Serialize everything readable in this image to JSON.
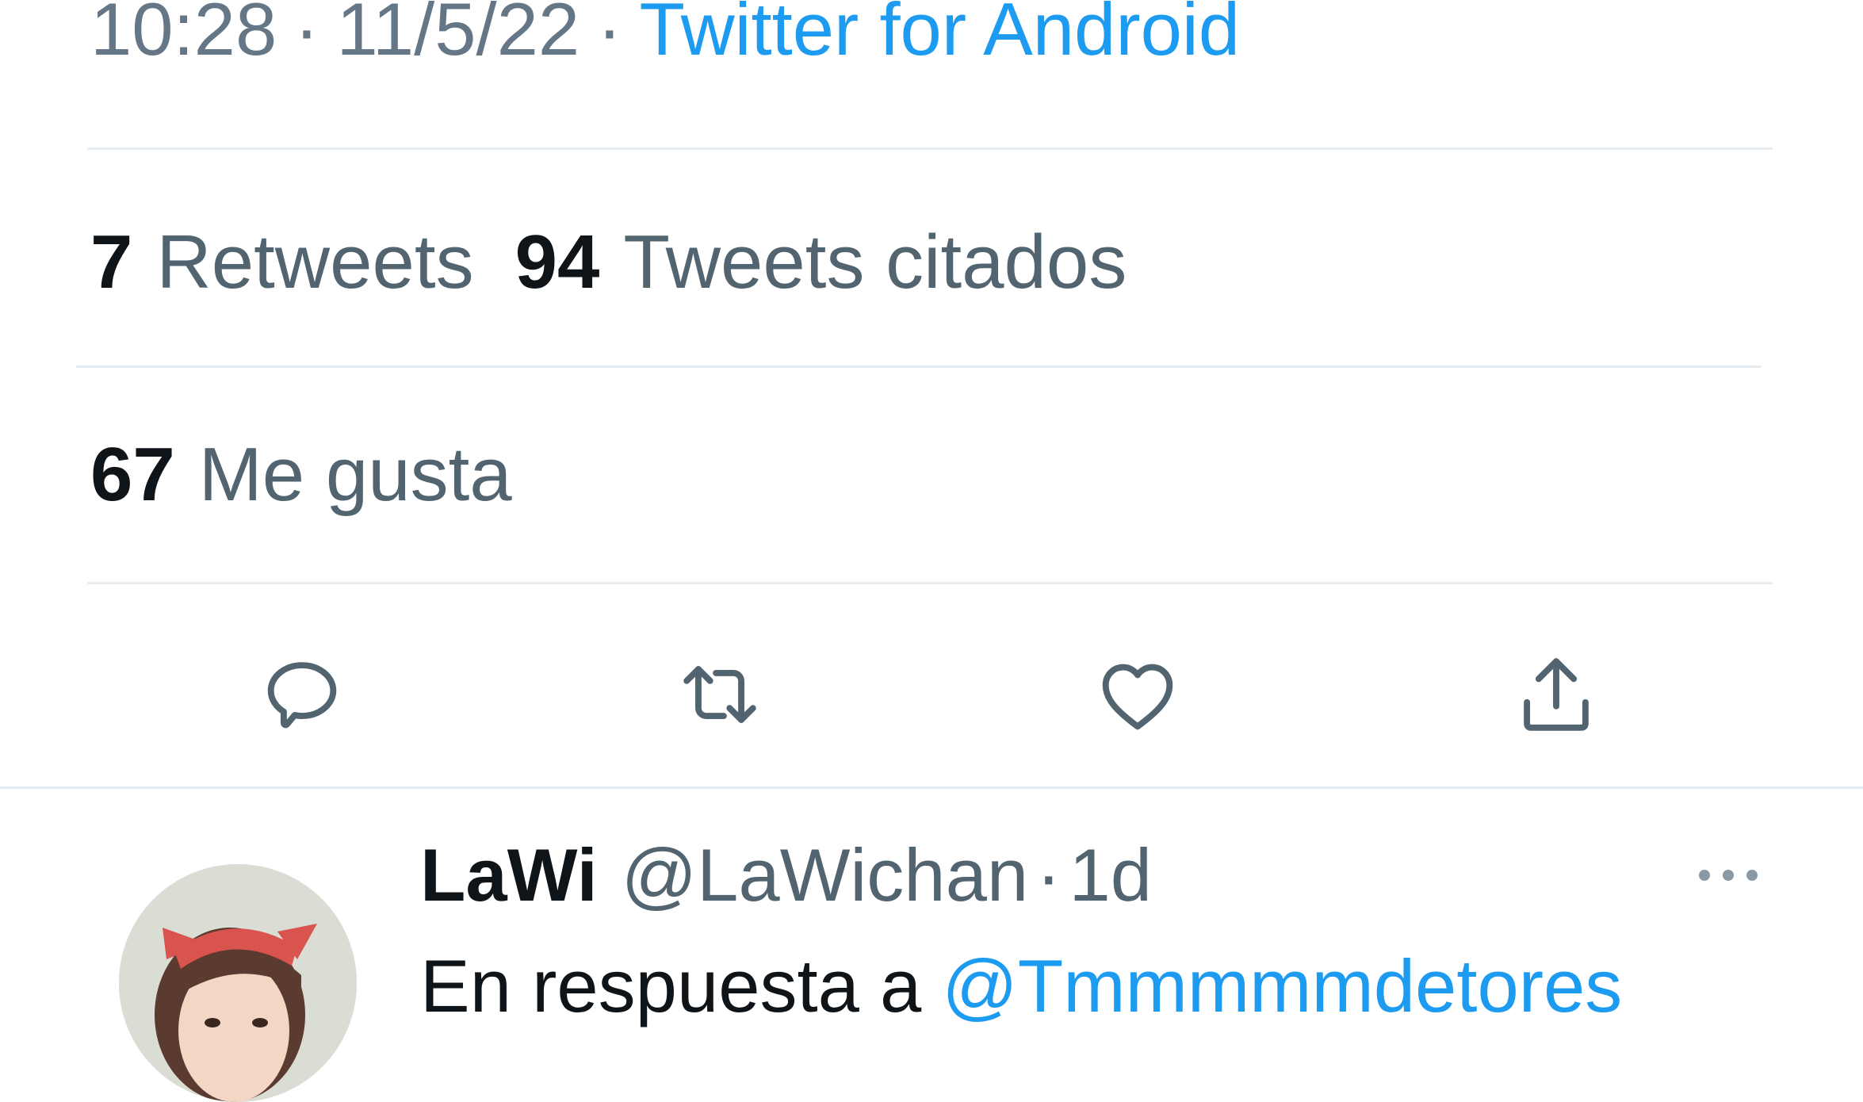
{
  "tweet_meta": {
    "time": "10:28",
    "separator": "·",
    "date": "11/5/22",
    "source": "Twitter for Android"
  },
  "stats": {
    "retweets_count": "7",
    "retweets_label": "Retweets",
    "quotes_count": "94",
    "quotes_label": "Tweets citados",
    "likes_count": "67",
    "likes_label": "Me gusta"
  },
  "actions": [
    {
      "icon": "reply-icon"
    },
    {
      "icon": "retweet-icon"
    },
    {
      "icon": "like-icon"
    },
    {
      "icon": "share-icon"
    }
  ],
  "reply": {
    "display_name": "LaWi",
    "handle": "@LaWichan",
    "separator": "·",
    "time": "1d",
    "text_prefix": "En respuesta a",
    "text_mention": "@Tmmmmmdetores"
  },
  "colors": {
    "accent": "#1d9bf0",
    "secondary_text": "#536471",
    "divider": "#e6ecf0"
  }
}
